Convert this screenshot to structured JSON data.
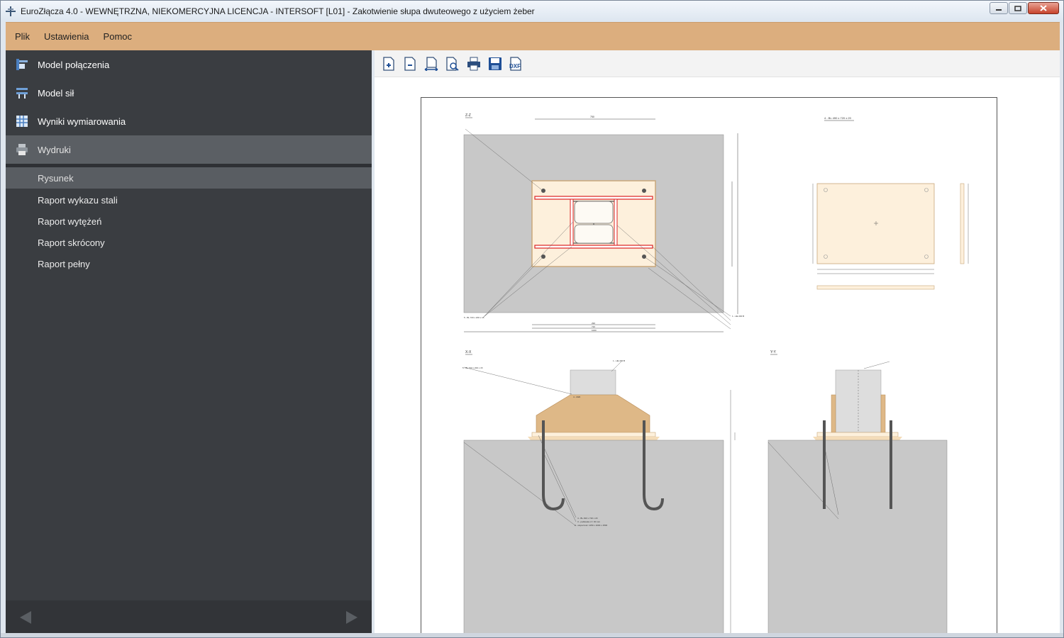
{
  "window": {
    "title": "EuroZłącza 4.0 - WEWNĘTRZNA, NIEKOMERCYJNA LICENCJA - INTERSOFT [L01] - Zakotwienie słupa dwuteowego z użyciem żeber"
  },
  "menu": {
    "items": [
      "Plik",
      "Ustawienia",
      "Pomoc"
    ]
  },
  "sidebar": {
    "nav": [
      {
        "label": "Model połączenia",
        "icon": "connection-model-icon"
      },
      {
        "label": "Model sił",
        "icon": "force-model-icon"
      },
      {
        "label": "Wyniki wymiarowania",
        "icon": "design-results-icon"
      },
      {
        "label": "Wydruki",
        "icon": "printer-icon",
        "active": true
      }
    ],
    "sub": [
      {
        "label": "Rysunek",
        "active": true
      },
      {
        "label": "Raport wykazu stali"
      },
      {
        "label": "Raport wytężeń"
      },
      {
        "label": "Raport skrócony"
      },
      {
        "label": "Raport pełny"
      }
    ]
  },
  "toolbar": {
    "buttons": [
      "zoom-in-icon",
      "zoom-out-icon",
      "fit-width-icon",
      "preview-icon",
      "print-icon",
      "save-icon",
      "dxf-export-icon"
    ],
    "dxf_label": "DXF"
  },
  "drawing": {
    "section_zz": "Z-Z",
    "section_xx": "X-X",
    "section_yy": "Y-Y",
    "plate_label": "4 - BL 490 x 720 x 20",
    "dim_top": "750",
    "dim_bottom_1": "290",
    "dim_bottom_2": "720",
    "dim_bottom_3": "1000",
    "label_1": "1 - HE 200 B",
    "label_2": "5 - BL 720 x 200 x 15",
    "label_3": "4 - M20",
    "label_4": "1 - HE 200 B",
    "label_5": "4 - BL 490 x 720 x 20",
    "label_6": "3 - podlewka d = 30 mm",
    "label_7": "2 - stopa fund. 1150 x 1000 x 1500"
  },
  "colors": {
    "menubar": "#dcae7e",
    "sidebar": "#3a3d41",
    "active": "#5b5f64",
    "concrete": "#c8c8c8",
    "plate": "#fdf0dc",
    "rib": "#deb887",
    "weld": "#d22"
  }
}
